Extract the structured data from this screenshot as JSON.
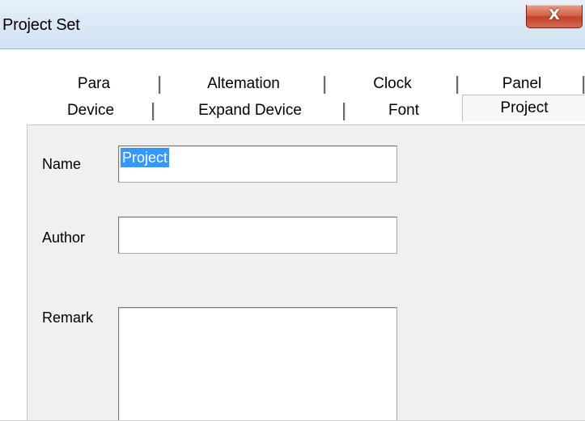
{
  "window": {
    "title": "Project Set",
    "close_glyph": "X",
    "close_icon": "close-icon"
  },
  "tabs": {
    "row_back": [
      {
        "label": "Para"
      },
      {
        "label": "Altemation"
      },
      {
        "label": "Clock"
      },
      {
        "label": "Panel"
      }
    ],
    "row_front": [
      {
        "label": "Device"
      },
      {
        "label": "Expand Device"
      },
      {
        "label": "Font"
      },
      {
        "label": "Project",
        "selected": true
      }
    ]
  },
  "form": {
    "name_label": "Name",
    "name_value": "Project",
    "author_label": "Author",
    "author_value": "",
    "remark_label": "Remark",
    "remark_value": ""
  },
  "colors": {
    "selection": "#3399ff",
    "close_button": "#c2412a",
    "panel_background": "#f0f0f0"
  }
}
